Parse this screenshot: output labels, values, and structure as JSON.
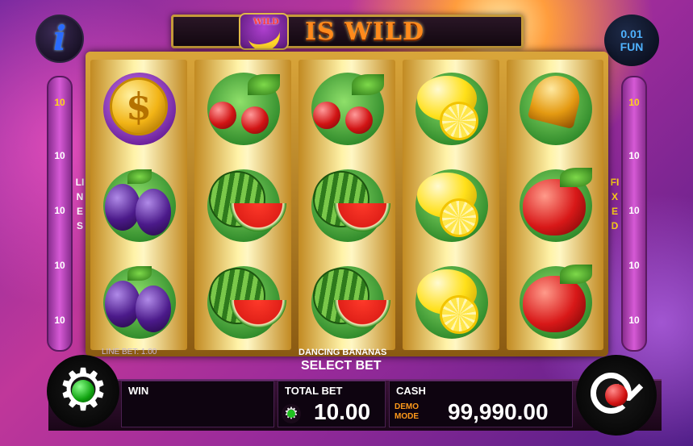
{
  "banner": {
    "badge_text": "WILD",
    "text": "IS WILD"
  },
  "info": {
    "icon": "info-icon",
    "glyph": "i"
  },
  "coin_display": {
    "value": "0.01",
    "mode": "FUN"
  },
  "left_lines": {
    "label": "LINES",
    "values": [
      "10",
      "10",
      "10",
      "10",
      "10"
    ]
  },
  "right_lines": {
    "label": "FIXED",
    "values": [
      "10",
      "10",
      "10",
      "10",
      "10"
    ]
  },
  "reels": [
    [
      "coin",
      "plum",
      "plum"
    ],
    [
      "cherries",
      "watermelon",
      "watermelon"
    ],
    [
      "cherries",
      "watermelon",
      "watermelon"
    ],
    [
      "lemon",
      "lemon",
      "lemon"
    ],
    [
      "bell",
      "apple",
      "apple"
    ]
  ],
  "coin_symbol_glyph": "$",
  "line_bet": "LINE BET: 1.00",
  "game_name": "DANCING BANANAS",
  "select_bet": "SELECT BET",
  "win": {
    "label": "WIN",
    "value": ""
  },
  "total_bet": {
    "label": "TOTAL BET",
    "value": "10.00"
  },
  "cash": {
    "label": "CASH",
    "demo": "DEMO MODE",
    "value": "99,990.00"
  },
  "colors": {
    "accent_gold": "#d9a53a",
    "start_green": "#0fa10f",
    "spin_red": "#d10f0f"
  }
}
